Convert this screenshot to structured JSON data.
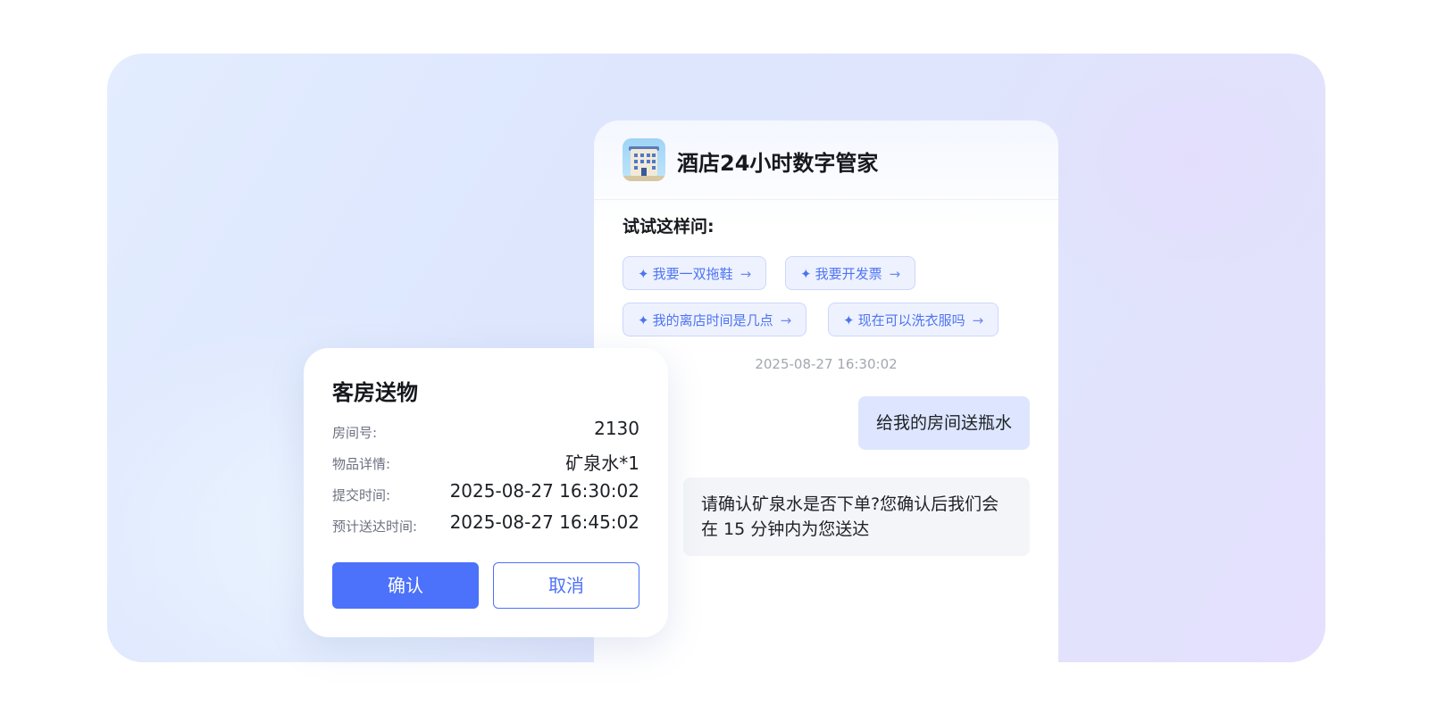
{
  "chat": {
    "title": "酒店24小时数字管家",
    "try_label": "试试这样问:",
    "suggestions": [
      {
        "label": "我要一双拖鞋"
      },
      {
        "label": "我要开发票"
      },
      {
        "label": "我的离店时间是几点"
      },
      {
        "label": "现在可以洗衣服吗"
      }
    ],
    "timestamp": "2025-08-27 16:30:02",
    "user_message": "给我的房间送瓶水",
    "bot_message": "请确认矿泉水是否下单?您确认后我们会在 15 分钟内为您送达"
  },
  "card": {
    "title": "客房送物",
    "fields": [
      {
        "key": "房间号:",
        "value": "2130"
      },
      {
        "key": "物品详情:",
        "value": "矿泉水*1"
      },
      {
        "key": "提交时间:",
        "value": "2025-08-27 16:30:02"
      },
      {
        "key": "预计送达时间:",
        "value": "2025-08-27 16:45:02"
      }
    ],
    "confirm_label": "确认",
    "cancel_label": "取消"
  },
  "icons": {
    "app_icon": "hotel-building-icon",
    "spark": "sparkle-icon",
    "arrow": "arrow-right-icon"
  },
  "colors": {
    "accent": "#4c71fb",
    "chip_text": "#4e74f0",
    "user_bubble": "#dde6fe",
    "bot_bubble": "#f3f5f8"
  }
}
